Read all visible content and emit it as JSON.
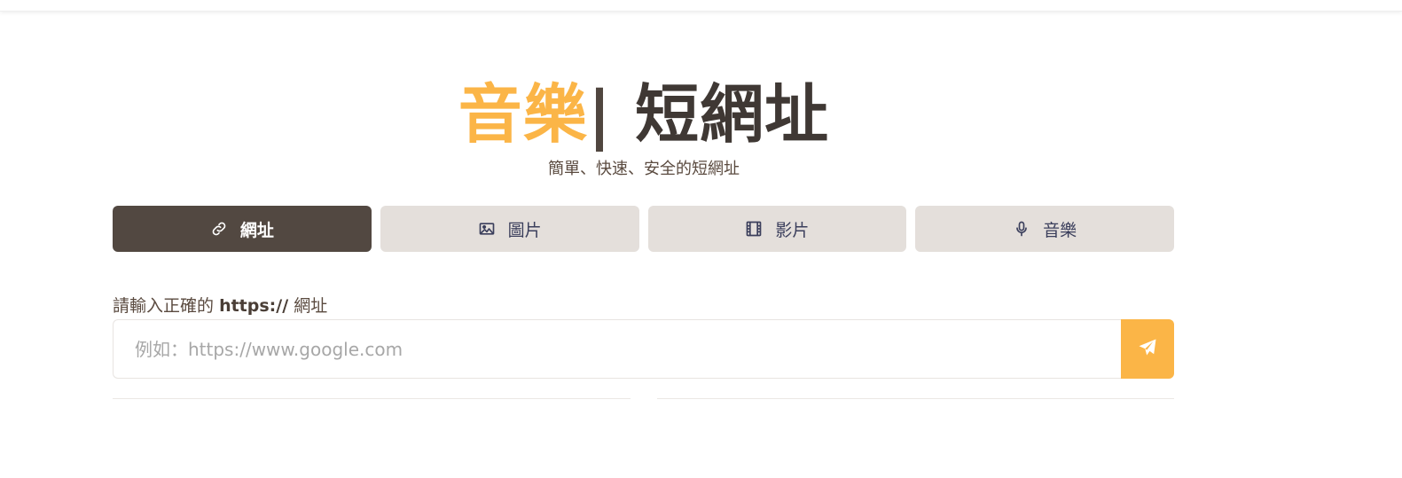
{
  "hero": {
    "title_accent": "音樂",
    "title_separator": "|",
    "title_main": " 短網址",
    "subtitle": "簡單、快速、安全的短網址"
  },
  "tabs": [
    {
      "label": "網址",
      "icon": "link-icon",
      "active": true
    },
    {
      "label": "圖片",
      "icon": "image-icon",
      "active": false
    },
    {
      "label": "影片",
      "icon": "film-icon",
      "active": false
    },
    {
      "label": "音樂",
      "icon": "microphone-icon",
      "active": false
    }
  ],
  "form": {
    "label_prefix": "請輸入正確的",
    "label_bold": "https://",
    "label_suffix": "網址",
    "placeholder": "例如：https://www.google.com",
    "value": "",
    "submit_icon": "send-icon"
  },
  "colors": {
    "accent": "#fbb547",
    "dark": "#524841",
    "tab_bg": "#e4dfdb",
    "tab_text": "#3b3f5c"
  }
}
